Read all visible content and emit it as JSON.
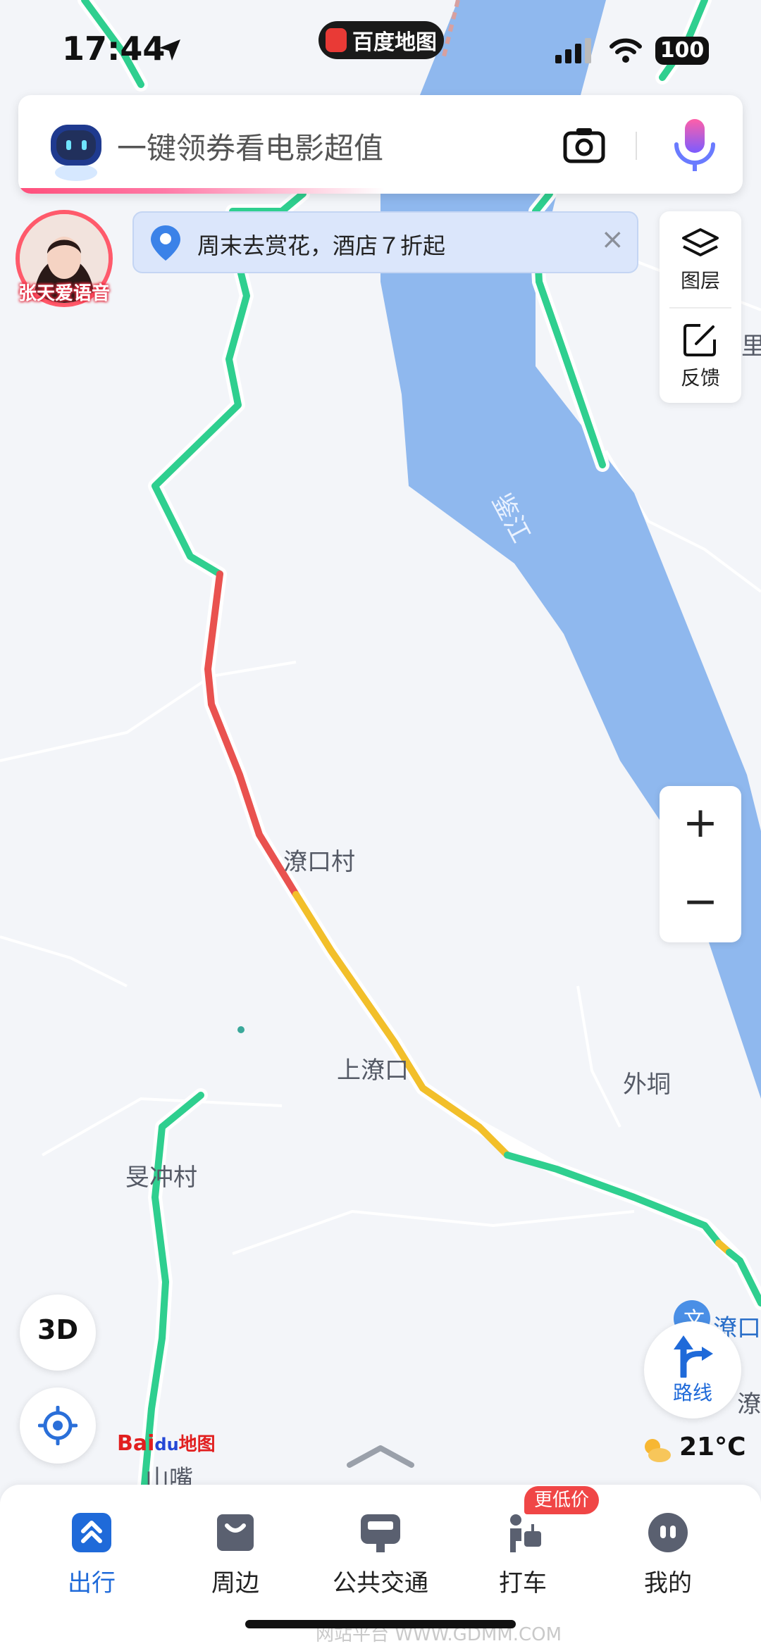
{
  "status_bar": {
    "time": "17:44",
    "app_pill": "百度地图",
    "battery": "100"
  },
  "search": {
    "placeholder": "一键领券看电影超值"
  },
  "voice_avatar": {
    "label": "张天爱语音"
  },
  "banner": {
    "text": "周末去赏花，酒店７折起",
    "close": "×"
  },
  "right_panel": {
    "layers_label": "图层",
    "feedback_label": "反馈"
  },
  "zoom": {
    "in_label": "+",
    "out_label": "−"
  },
  "map": {
    "river_label": "鉴江",
    "labels": {
      "liaokou_village": "潦口村",
      "shang_liaokou": "上潦口",
      "waitong": "外垌",
      "minchong_village": "旻冲村",
      "shanzui": "山嘴",
      "liaokou_poi": "潦口",
      "liao_partial": "潦",
      "edge_partial": "里"
    }
  },
  "controls": {
    "btn_3d": "3D",
    "route_label": "路线",
    "temperature": "21°C"
  },
  "logo": {
    "bai": "Bai",
    "du": "du",
    "ditu": "地图"
  },
  "nav": {
    "tabs": [
      {
        "label": "出行",
        "icon": "travel-icon",
        "active": true
      },
      {
        "label": "周边",
        "icon": "nearby-icon",
        "active": false
      },
      {
        "label": "公共交通",
        "icon": "bus-icon",
        "active": false
      },
      {
        "label": "打车",
        "icon": "taxi-icon",
        "active": false
      },
      {
        "label": "我的",
        "icon": "profile-icon",
        "active": false
      }
    ],
    "taxi_badge": "更低价"
  },
  "watermark": "网站平台 WWW.GDMM.COM",
  "colors": {
    "accent": "#1f6ad9",
    "road_green": "#2fcf8f",
    "road_red": "#e9524f",
    "road_yellow": "#f2bf2a",
    "river": "#8fb8ee",
    "map_bg": "#f3f5f9"
  }
}
